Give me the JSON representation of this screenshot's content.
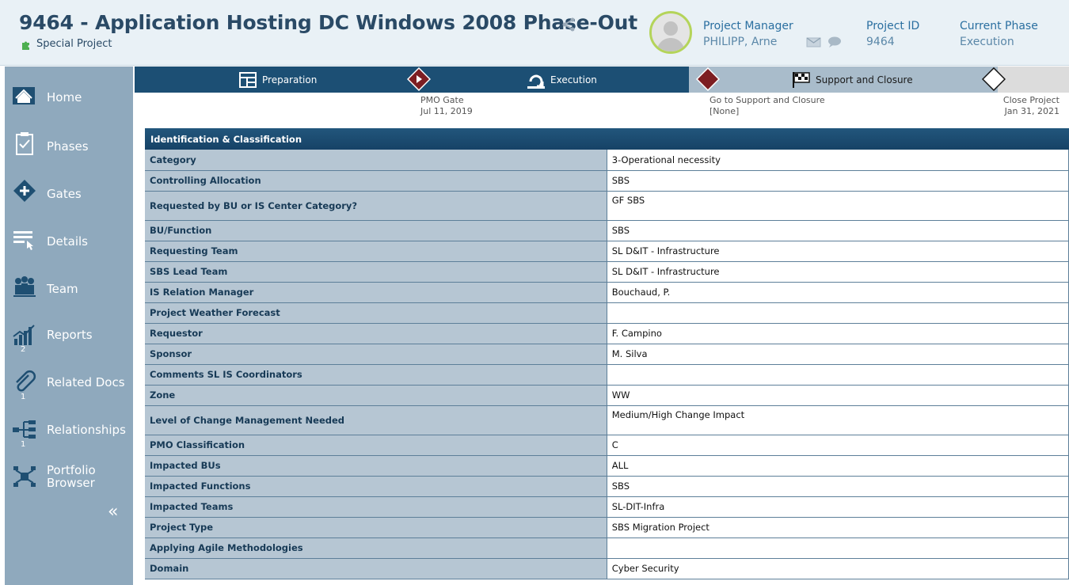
{
  "header": {
    "title": "9464 - Application Hosting DC Windows 2008 Phase-Out",
    "subtitle": "Special Project",
    "project_manager_label": "Project Manager",
    "project_manager_value": "PHILIPP, Arne",
    "project_id_label": "Project ID",
    "project_id_value": "9464",
    "current_phase_label": "Current Phase",
    "current_phase_value": "Execution"
  },
  "sidebar": {
    "items": [
      {
        "label": "Home",
        "icon": "home-icon"
      },
      {
        "label": "Phases",
        "icon": "clipboard-icon"
      },
      {
        "label": "Gates",
        "icon": "gate-icon"
      },
      {
        "label": "Details",
        "icon": "details-icon"
      },
      {
        "label": "Team",
        "icon": "team-icon"
      },
      {
        "label": "Reports",
        "icon": "chart-icon",
        "count": "2"
      },
      {
        "label": "Related Docs",
        "icon": "paperclip-icon",
        "count": "1"
      },
      {
        "label": "Relationships",
        "icon": "relationships-icon",
        "count": "1"
      },
      {
        "label": "Portfolio Browser",
        "icon": "portfolio-icon"
      }
    ],
    "collapse": "«"
  },
  "phases": [
    {
      "label": "Preparation",
      "icon": "layout-icon"
    },
    {
      "label": "Execution",
      "icon": "cycle-icon"
    },
    {
      "label": "Support and Closure",
      "icon": "checkered-flag-icon"
    }
  ],
  "gates": [
    {
      "name": "PMO Gate",
      "date": "Jul 11, 2019"
    },
    {
      "name": "Go to Support and Closure",
      "date": "[None]"
    },
    {
      "name": "Close Project",
      "date": "Jan 31, 2021"
    }
  ],
  "table": {
    "header": "Identification & Classification",
    "rows": [
      {
        "key": "Category",
        "value": "3-Operational necessity"
      },
      {
        "key": "Controlling Allocation",
        "value": "SBS"
      },
      {
        "key": "Requested by BU or IS Center Category?",
        "value": "GF SBS"
      },
      {
        "key": "BU/Function",
        "value": "SBS"
      },
      {
        "key": "Requesting Team",
        "value": "SL D&IT - Infrastructure"
      },
      {
        "key": "SBS Lead Team",
        "value": "SL D&IT - Infrastructure"
      },
      {
        "key": "IS Relation Manager",
        "value": "Bouchaud, P."
      },
      {
        "key": "Project Weather Forecast",
        "value": ""
      },
      {
        "key": "Requestor",
        "value": "F. Campino"
      },
      {
        "key": "Sponsor",
        "value": "M. Silva"
      },
      {
        "key": "Comments SL IS Coordinators",
        "value": ""
      },
      {
        "key": "Zone",
        "value": "WW"
      },
      {
        "key": "Level of Change Management Needed",
        "value": "Medium/High Change Impact"
      },
      {
        "key": "PMO Classification",
        "value": "C"
      },
      {
        "key": "Impacted BUs",
        "value": "ALL"
      },
      {
        "key": "Impacted Functions",
        "value": "SBS"
      },
      {
        "key": "Impacted Teams",
        "value": "SL-DIT-Infra"
      },
      {
        "key": "Project Type",
        "value": "SBS Migration Project"
      },
      {
        "key": "Applying Agile Methodologies",
        "value": ""
      },
      {
        "key": "Domain",
        "value": "Cyber Security"
      }
    ]
  },
  "colors": {
    "header_bg": "#e9f1f6",
    "title": "#2a4a66",
    "sidebar_bg": "#8fa9bd",
    "phasebar_bg": "#1c4f74",
    "gate_diamond": "#7d1e22",
    "table_key_bg": "#b6c6d3"
  }
}
